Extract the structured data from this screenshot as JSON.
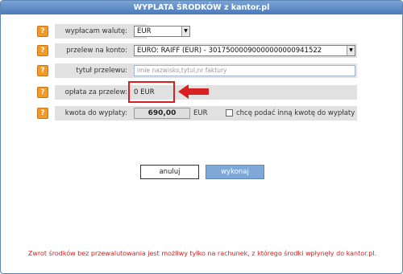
{
  "window": {
    "title": "WYPLATA ŚRODKÓW z kantor.pl"
  },
  "help_glyph": "?",
  "form": {
    "currency": {
      "label": "wypłacam walutę:",
      "value": "EUR"
    },
    "transfer": {
      "label": "przelew na konto:",
      "value": "EURO: RAIFF (EUR) - 30175000090000000000941522"
    },
    "title": {
      "label": "tytuł przelewu:",
      "placeholder": "imie nazwisko,tytul,nr faktury"
    },
    "fee": {
      "label": "opłata za przelew:",
      "value": "0 EUR"
    },
    "amount": {
      "label": "kwota do wypłaty:",
      "value": "690,00",
      "currency": "EUR",
      "checkbox_label": "chcę podać inną kwotę do wypłaty",
      "checkbox_checked": false
    }
  },
  "buttons": {
    "cancel": "anuluj",
    "pay": "wykonaj"
  },
  "footer": {
    "note": "Zwrot środków bez przewalutowania jest możliwy tylko na rachunek, z którego środki wpłynęły do kantor.pl."
  },
  "colors": {
    "accent": "#4b7ab8",
    "help": "#f39a25",
    "highlight": "#d92020"
  }
}
